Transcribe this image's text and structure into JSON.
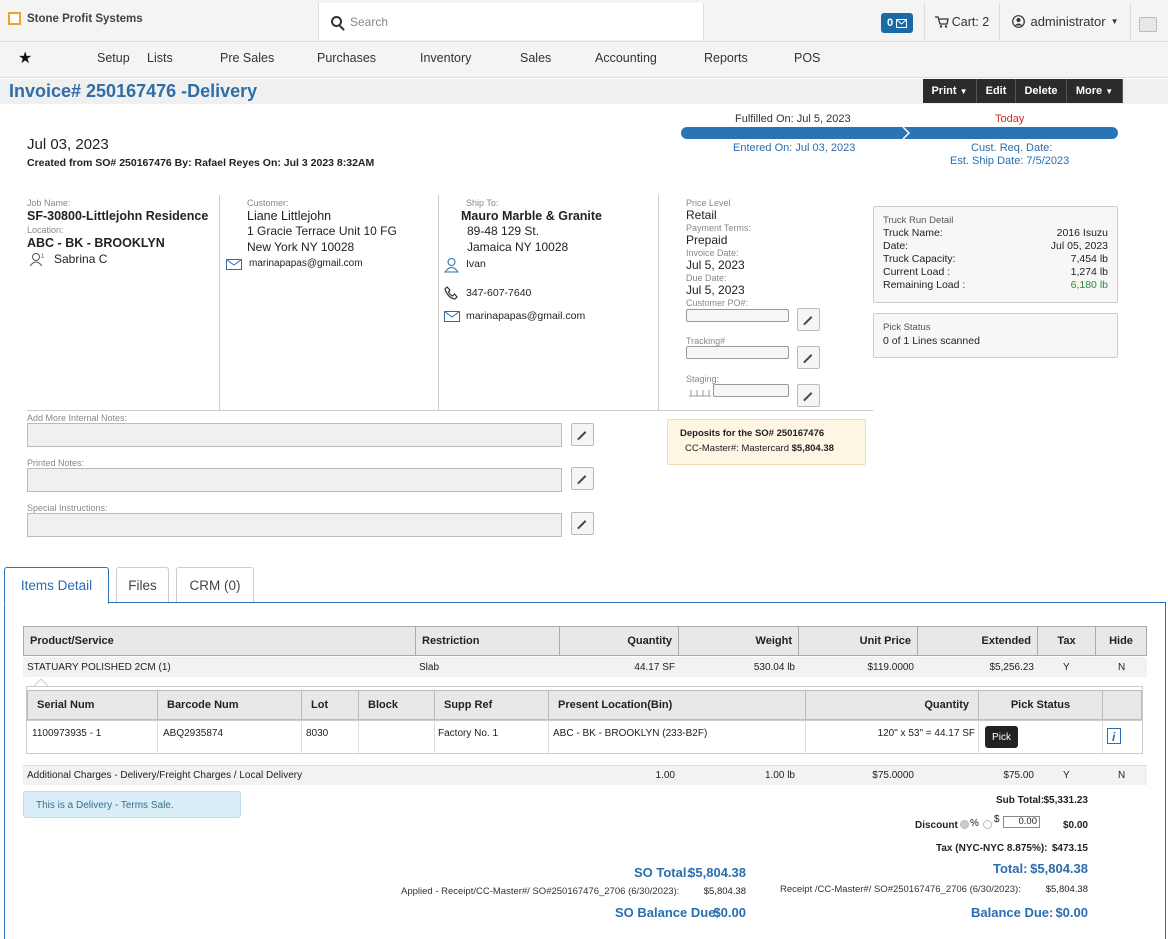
{
  "header": {
    "brand": "Stone Profit Systems",
    "search_placeholder": "Search",
    "msg_count": "0",
    "cart_label": "Cart: 2",
    "user": "administrator"
  },
  "nav": [
    "Setup",
    "Lists",
    "Pre Sales",
    "Purchases",
    "Inventory",
    "Sales",
    "Accounting",
    "Reports",
    "POS"
  ],
  "title": "Invoice# 250167476 -Delivery",
  "actions": [
    "Print",
    "Edit",
    "Delete",
    "More"
  ],
  "progress": {
    "fulfilled": "Fulfilled On: Jul 5, 2023",
    "today": "Today",
    "entered": "Entered On: Jul 03, 2023",
    "cust_req": "Cust. Req. Date:",
    "est_ship": "Est. Ship Date: 7/5/2023"
  },
  "doc": {
    "date": "Jul 03, 2023",
    "created": "Created from SO# 250167476 By: Rafael Reyes On: Jul 3 2023 8:32AM"
  },
  "job": {
    "job_label": "Job Name:",
    "job_name": "SF-30800-Littlejohn Residence",
    "loc_label": "Location:",
    "location": "ABC - BK - BROOKLYN",
    "rep": "Sabrina C"
  },
  "customer": {
    "label": "Customer:",
    "name": "Liane Littlejohn",
    "addr1": "1 Gracie Terrace Unit 10 FG",
    "addr2": "New York NY 10028",
    "email": "marinapapas@gmail.com"
  },
  "shipto": {
    "label": "Ship To:",
    "name": "Mauro Marble & Granite",
    "addr1": "89-48 129 St.",
    "addr2": "Jamaica NY 10028",
    "contact": "Ivan",
    "phone": "347-607-7640",
    "email": "marinapapas@gmail.com"
  },
  "terms": {
    "price_level_label": "Price Level",
    "price_level": "Retail",
    "payment_terms_label": "Payment Terms:",
    "payment_terms": "Prepaid",
    "invoice_date_label": "Invoice Date:",
    "invoice_date": "Jul 5, 2023",
    "due_date_label": "Due Date:",
    "due_date": "Jul 5, 2023",
    "customer_po_label": "Customer PO#:",
    "tracking_label": "Tracking#",
    "staging_label": "Staging:"
  },
  "truck": {
    "title": "Truck Run Detail",
    "rows": [
      {
        "k": "Truck Name:",
        "v": "2016 Isuzu"
      },
      {
        "k": "Date:",
        "v": "Jul 05, 2023"
      },
      {
        "k": "Truck Capacity:",
        "v": "7,454 lb"
      },
      {
        "k": "Current Load :",
        "v": "1,274 lb"
      },
      {
        "k": "Remaining Load :",
        "v": "6,180 lb"
      }
    ]
  },
  "pick": {
    "title": "Pick Status",
    "value": "0 of 1 Lines scanned"
  },
  "notes": {
    "internal": "Add More Internal Notes:",
    "printed": "Printed Notes:",
    "special": "Special Instructions:"
  },
  "deposits": {
    "title": "Deposits for the SO# 250167476",
    "method": "CC-Master#: Mastercard",
    "amount": "$5,804.38"
  },
  "tabs": [
    "Items Detail",
    "Files",
    "CRM (0)"
  ],
  "items": {
    "headers": [
      "Product/Service",
      "Restriction",
      "Quantity",
      "Weight",
      "Unit Price",
      "Extended",
      "Tax",
      "Hide"
    ],
    "row1": [
      "STATUARY POLISHED 2CM (1)",
      "Slab",
      "44.17 SF",
      "530.04 lb",
      "$119.0000",
      "$5,256.23",
      "Y",
      "N"
    ],
    "row2": [
      "Additional Charges - Delivery/Freight Charges / Local Delivery",
      "",
      "1.00",
      "1.00 lb",
      "$75.0000",
      "$75.00",
      "Y",
      "N"
    ]
  },
  "serials": {
    "headers": [
      "Serial Num",
      "Barcode Num",
      "Lot",
      "Block",
      "Supp Ref",
      "Present Location(Bin)",
      "Quantity",
      "Pick Status"
    ],
    "row": [
      "1100973935 - 1",
      "ABQ2935874",
      "8030",
      "",
      "Factory No. 1",
      "ABC - BK - BROOKLYN (233-B2F)",
      "120\" x 53\" = 44.17 SF"
    ],
    "pick_btn": "Pick"
  },
  "delivery_note": "This is a Delivery - Terms Sale.",
  "totals": {
    "subtotal_label": "Sub Total:",
    "subtotal": "$5,331.23",
    "discount_label": "Discount",
    "discount_input": "0.00",
    "discount": "$0.00",
    "tax_label": "Tax (NYC-NYC  8.875%):",
    "tax": "$473.15",
    "total_label": "Total:",
    "total": "$5,804.38",
    "receipt": "Receipt /CC-Master#/ SO#250167476_2706 (6/30/2023):",
    "receipt_amt": "$5,804.38",
    "balance_label": "Balance Due:",
    "balance": "$0.00",
    "so_total_label": "SO Total:",
    "so_total": "$5,804.38",
    "applied": "Applied - Receipt/CC-Master#/ SO#250167476_2706 (6/30/2023):",
    "applied_amt": "$5,804.38",
    "so_balance_label": "SO Balance Due:",
    "so_balance": "$0.00"
  },
  "colors": {
    "accent": "#2a73b7",
    "remaining_load": "#2e8b2e",
    "today": "#d9241c"
  }
}
